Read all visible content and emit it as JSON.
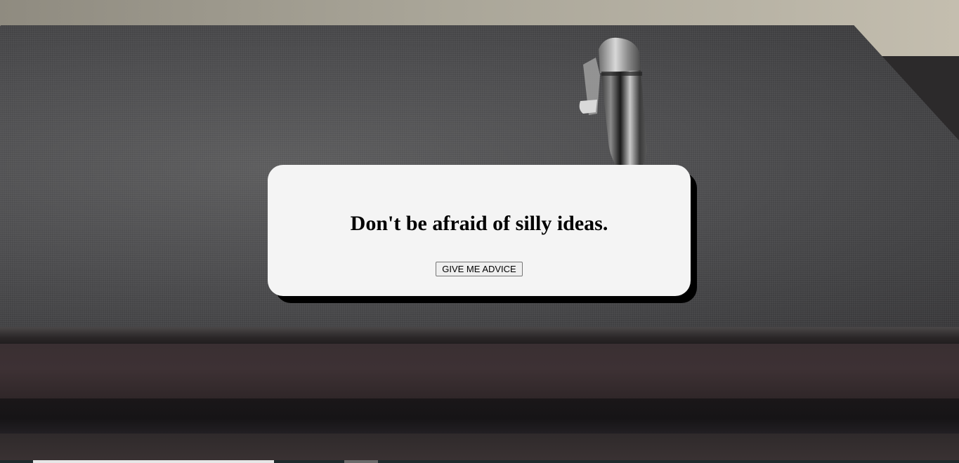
{
  "advice": {
    "text": "Don't be afraid of silly ideas.",
    "button_label": "GIVE ME ADVICE"
  },
  "background": {
    "description_icon": "notebook-with-pen-photo"
  },
  "colors": {
    "card_background": "#f4f4f4",
    "card_shadow": "#000000",
    "text": "#000000"
  }
}
